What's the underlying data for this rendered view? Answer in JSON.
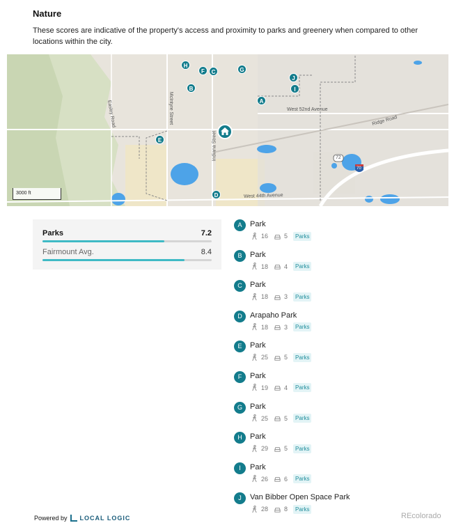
{
  "section": {
    "title": "Nature",
    "description": "These scores are indicative of the property's access and proximity to parks and greenery when compared to other locations within the city."
  },
  "map": {
    "scale_label": "3000 ft",
    "road_labels": {
      "easley": "Easley Road",
      "mcintyre": "McIntyre Street",
      "indiana": "Indiana Street",
      "w52": "West 52nd Avenue",
      "ridge": "Ridge Road",
      "w44": "West 44th Avenue",
      "hwy72": "72",
      "i70": "70"
    },
    "markers": [
      "H",
      "F",
      "C",
      "G",
      "J",
      "I",
      "B",
      "A",
      "E",
      "D"
    ]
  },
  "scores": {
    "parks_label": "Parks",
    "parks_value": "7.2",
    "parks_fraction": 0.72,
    "avg_label": "Fairmount Avg.",
    "avg_value": "8.4",
    "avg_fraction": 0.84
  },
  "places": [
    {
      "letter": "A",
      "name": "Park",
      "walk": "16",
      "drive": "5",
      "tag": "Parks"
    },
    {
      "letter": "B",
      "name": "Park",
      "walk": "18",
      "drive": "4",
      "tag": "Parks"
    },
    {
      "letter": "C",
      "name": "Park",
      "walk": "18",
      "drive": "3",
      "tag": "Parks"
    },
    {
      "letter": "D",
      "name": "Arapaho Park",
      "walk": "18",
      "drive": "3",
      "tag": "Parks"
    },
    {
      "letter": "E",
      "name": "Park",
      "walk": "25",
      "drive": "5",
      "tag": "Parks"
    },
    {
      "letter": "F",
      "name": "Park",
      "walk": "19",
      "drive": "4",
      "tag": "Parks"
    },
    {
      "letter": "G",
      "name": "Park",
      "walk": "25",
      "drive": "5",
      "tag": "Parks"
    },
    {
      "letter": "H",
      "name": "Park",
      "walk": "29",
      "drive": "5",
      "tag": "Parks"
    },
    {
      "letter": "I",
      "name": "Park",
      "walk": "26",
      "drive": "6",
      "tag": "Parks"
    },
    {
      "letter": "J",
      "name": "Van Bibber Open Space Park",
      "walk": "28",
      "drive": "8",
      "tag": "Parks"
    }
  ],
  "footer": {
    "powered_by": "Powered by",
    "brand": "LOCAL LOGIC",
    "watermark": "REcolorado"
  }
}
